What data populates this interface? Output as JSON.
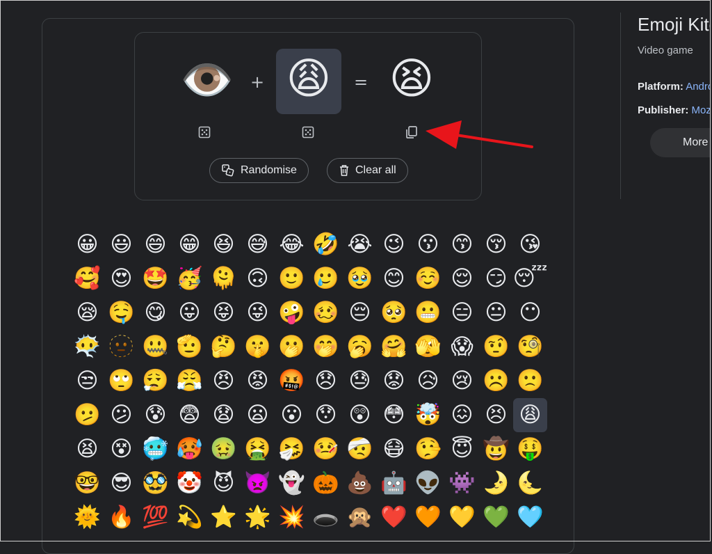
{
  "mixer": {
    "left_emoji": "👁️",
    "operator_plus": "+",
    "right_emoji": "😩",
    "operator_equals": "=",
    "result_emoji": "😫",
    "randomise_label": "Randomise",
    "clear_label": "Clear all"
  },
  "grid": {
    "selected_index": 83,
    "emojis": [
      "😀",
      "😃",
      "😄",
      "😁",
      "😆",
      "😅",
      "😂",
      "🤣",
      "😭",
      "😉",
      "😗",
      "😙",
      "😚",
      "😘",
      "🥰",
      "😍",
      "🤩",
      "🥳",
      "🫠",
      "🙃",
      "🙂",
      "🥲",
      "🥹",
      "😊",
      "☺️",
      "😌",
      "😏",
      "😴",
      "😪",
      "🤤",
      "😋",
      "😛",
      "😝",
      "😜",
      "🤪",
      "🥴",
      "😔",
      "🥺",
      "😬",
      "😑",
      "😐",
      "😶",
      "😶‍🌫️",
      "🫥",
      "🤐",
      "🫡",
      "🤔",
      "🤫",
      "🫢",
      "🤭",
      "🥱",
      "🤗",
      "🫣",
      "😱",
      "🤨",
      "🧐",
      "😒",
      "🙄",
      "😮‍💨",
      "😤",
      "😠",
      "😡",
      "🤬",
      "😞",
      "😓",
      "😟",
      "😥",
      "😢",
      "☹️",
      "🙁",
      "🫤",
      "😕",
      "😰",
      "😨",
      "😧",
      "😦",
      "😮",
      "😯",
      "😲",
      "😳",
      "🤯",
      "😖",
      "😣",
      "😩",
      "😫",
      "😵",
      "🥶",
      "🥵",
      "🤢",
      "🤮",
      "🤧",
      "🤒",
      "🤕",
      "😷",
      "🤥",
      "😇",
      "🤠",
      "🤑",
      "🤓",
      "😎",
      "🥸",
      "🤡",
      "😈",
      "👿",
      "👻",
      "🎃",
      "💩",
      "🤖",
      "👽",
      "👾",
      "🌛",
      "🌜",
      "🌞",
      "🔥",
      "💯",
      "💫",
      "⭐",
      "🌟",
      "💥",
      "🕳️",
      "🙊",
      "❤️",
      "🧡",
      "💛",
      "💚",
      "🩵"
    ]
  },
  "side_panel": {
    "title": "Emoji Kitchen",
    "subtitle": "Video game",
    "platform_label": "Platform:",
    "platform_value": "Android",
    "publisher_label": "Publisher:",
    "publisher_value": "Mozilla",
    "more_label": "More"
  },
  "colors": {
    "background": "#202124",
    "card_border": "#3c4043",
    "selected_bg": "#3a3f4b",
    "link": "#8ab4f8",
    "arrow": "#e8151b"
  }
}
